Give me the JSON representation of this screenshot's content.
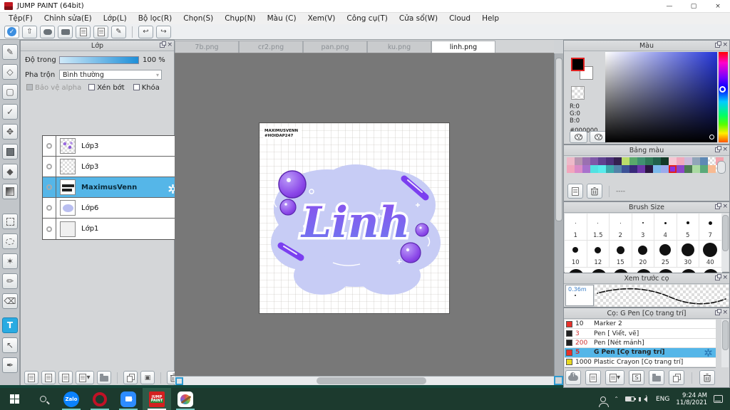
{
  "window": {
    "title": "JUMP PAINT (64bit)",
    "minimize": "—",
    "maximize": "▢",
    "close": "×"
  },
  "menu": {
    "items": [
      "Tệp(F)",
      "Chỉnh sửa(E)",
      "Lớp(L)",
      "Bộ lọc(R)",
      "Chọn(S)",
      "Chụp(N)",
      "Màu (C)",
      "Xem(V)",
      "Công cụ(T)",
      "Cửa sổ(W)",
      "Cloud",
      "Help"
    ]
  },
  "toolbar": {
    "undo": "↩",
    "redo": "↪",
    "check": "✓"
  },
  "tabs": [
    "7b.png",
    "cr2.png",
    "pan.png",
    "ku.png",
    "linh.png"
  ],
  "layer_panel": {
    "title": "Lớp",
    "opacity_label": "Độ trong",
    "opacity_value": "100 %",
    "blend_label": "Pha trộn",
    "blend_value": "Bình thường",
    "cb_alpha": "Bảo vệ alpha",
    "cb_clip": "Xén bớt",
    "cb_lock": "Khóa",
    "layers": [
      {
        "name": "Lớp3"
      },
      {
        "name": "Lớp3"
      },
      {
        "name": "MaximusVenn",
        "selected": true
      },
      {
        "name": "Lớp6"
      },
      {
        "name": "Lớp1"
      }
    ]
  },
  "canvas": {
    "watermark1": "MAXIMUSVENN",
    "watermark2": "#HOIDAP247",
    "art_text": "Linh"
  },
  "color_panel": {
    "title": "Màu",
    "r": "R:0",
    "g": "G:0",
    "b": "B:0",
    "hex": "#000000"
  },
  "palette_panel": {
    "title": "Bảng màu",
    "dashes": "----",
    "row1": [
      "#eeb9c9",
      "#b795b1",
      "#9b70b1",
      "#7f58a9",
      "#604291",
      "#4b3079",
      "#342050",
      "#badc6b",
      "#59a96b",
      "#409171",
      "#307b59",
      "#21614b",
      "#133927",
      "#f5c7d3",
      "#f1a9bd",
      "#ccbbd9",
      "#91a5b9",
      "#5e89b5",
      "",
      "#f3a3ad"
    ],
    "row2": [
      "#f2a6bc",
      "#da8cc8",
      "#a872cc",
      "#52e2e2",
      "#58ecec",
      "#3caaaa",
      "#5282a8",
      "#3c5296",
      "#38297a",
      "#6c38a8",
      "#2c1642",
      "#7cbaec",
      "#9caaec",
      {
        "c": "#8b2fe0",
        "sel": true
      },
      "#8c46ca",
      "#4c7c52",
      "#aadaa2",
      "#5aaa7a",
      "#f8ba92",
      ""
    ]
  },
  "brush_size_panel": {
    "title": "Brush Size",
    "row1": [
      "1",
      "1.5",
      "2",
      "3",
      "4",
      "5",
      "7"
    ],
    "row2": [
      "10",
      "12",
      "15",
      "20",
      "25",
      "30",
      "40"
    ]
  },
  "preview_panel": {
    "title": "Xem trước cọ",
    "value": "0.36m"
  },
  "brush_panel": {
    "title": "Cọ: G Pen [Cọ trang trí]",
    "brushes": [
      {
        "color": "#e8302a",
        "size": "10",
        "name": "Marker 2"
      },
      {
        "color": "#222222",
        "size": "3",
        "name": "Pen [ Viết, vẽ]"
      },
      {
        "color": "#222222",
        "size": "200",
        "name": "Pen [Nét mảnh]"
      },
      {
        "color": "#e8302a",
        "size": "5",
        "name": "G Pen [Cọ trang trí]",
        "selected": true
      },
      {
        "color": "#e8d820",
        "size": "1000",
        "name": "Plastic Crayon [Cọ trang trí]"
      }
    ]
  },
  "taskbar": {
    "zalo": "Zalo",
    "jump1": "JUMP",
    "jump2": "PAINT",
    "lang": "ENG",
    "time": "9:24 AM",
    "date": "11/8/2021"
  }
}
